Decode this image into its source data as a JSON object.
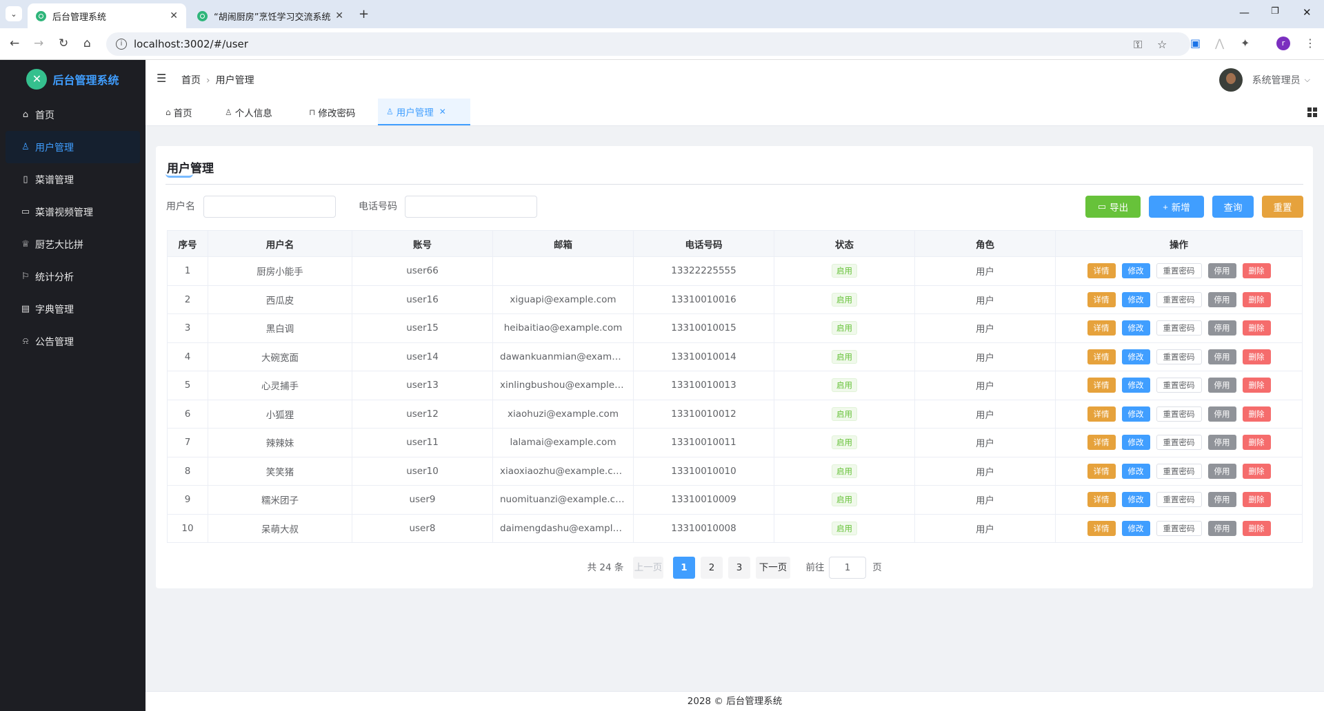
{
  "browser": {
    "tabs": [
      {
        "title": "后台管理系统",
        "active": true
      },
      {
        "title": "“胡闹厨房”烹饪学习交流系统",
        "active": false
      }
    ],
    "url": "localhost:3002/#/user",
    "profile_initial": "r"
  },
  "sidebar": {
    "app_title": "后台管理系统",
    "items": [
      {
        "label": "首页",
        "icon": "home-icon"
      },
      {
        "label": "用户管理",
        "icon": "user-icon",
        "active": true
      },
      {
        "label": "菜谱管理",
        "icon": "notebook-icon"
      },
      {
        "label": "菜谱视频管理",
        "icon": "video-icon"
      },
      {
        "label": "厨艺大比拼",
        "icon": "trophy-icon"
      },
      {
        "label": "统计分析",
        "icon": "flag-icon"
      },
      {
        "label": "字典管理",
        "icon": "document-icon"
      },
      {
        "label": "公告管理",
        "icon": "bell-icon"
      }
    ]
  },
  "header": {
    "breadcrumb": [
      "首页",
      "用户管理"
    ],
    "username": "系统管理员"
  },
  "tags": [
    {
      "label": "首页",
      "icon": "home-icon"
    },
    {
      "label": "个人信息",
      "icon": "user-icon"
    },
    {
      "label": "修改密码",
      "icon": "lock-icon"
    },
    {
      "label": "用户管理",
      "icon": "user-icon",
      "active": true
    }
  ],
  "page": {
    "title": "用户管理",
    "filters": {
      "username_label": "用户名",
      "username_value": "",
      "phone_label": "电话号码",
      "phone_value": ""
    },
    "buttons": {
      "export": "导出",
      "add": "新增",
      "query": "查询",
      "reset": "重置"
    },
    "columns": [
      "序号",
      "用户名",
      "账号",
      "邮箱",
      "电话号码",
      "状态",
      "角色",
      "操作"
    ],
    "row_actions": {
      "detail": "详情",
      "edit": "修改",
      "reset_pwd": "重置密码",
      "disable": "停用",
      "delete": "删除"
    },
    "rows": [
      {
        "no": "1",
        "name": "厨房小能手",
        "account": "user66",
        "email": "",
        "phone": "13322225555",
        "status": "启用",
        "role": "用户"
      },
      {
        "no": "2",
        "name": "西瓜皮",
        "account": "user16",
        "email": "xiguapi@example.com",
        "phone": "13310010016",
        "status": "启用",
        "role": "用户"
      },
      {
        "no": "3",
        "name": "黑白调",
        "account": "user15",
        "email": "heibaitiao@example.com",
        "phone": "13310010015",
        "status": "启用",
        "role": "用户"
      },
      {
        "no": "4",
        "name": "大碗宽面",
        "account": "user14",
        "email": "dawankuanmian@example.com",
        "phone": "13310010014",
        "status": "启用",
        "role": "用户"
      },
      {
        "no": "5",
        "name": "心灵捕手",
        "account": "user13",
        "email": "xinlingbushou@example.com",
        "phone": "13310010013",
        "status": "启用",
        "role": "用户"
      },
      {
        "no": "6",
        "name": "小狐狸",
        "account": "user12",
        "email": "xiaohuzi@example.com",
        "phone": "13310010012",
        "status": "启用",
        "role": "用户"
      },
      {
        "no": "7",
        "name": "辣辣妹",
        "account": "user11",
        "email": "lalamai@example.com",
        "phone": "13310010011",
        "status": "启用",
        "role": "用户"
      },
      {
        "no": "8",
        "name": "笑笑猪",
        "account": "user10",
        "email": "xiaoxiaozhu@example.com",
        "phone": "13310010010",
        "status": "启用",
        "role": "用户"
      },
      {
        "no": "9",
        "name": "糯米团子",
        "account": "user9",
        "email": "nuomituanzi@example.com",
        "phone": "13310010009",
        "status": "启用",
        "role": "用户"
      },
      {
        "no": "10",
        "name": "呆萌大叔",
        "account": "user8",
        "email": "daimengdashu@example.com",
        "phone": "13310010008",
        "status": "启用",
        "role": "用户"
      }
    ],
    "pagination": {
      "total_text": "共 24 条",
      "prev": "上一页",
      "pages": [
        "1",
        "2",
        "3"
      ],
      "current": "1",
      "next": "下一页",
      "goto_prefix": "前往",
      "goto_value": "1",
      "goto_suffix": "页"
    }
  },
  "footer": {
    "text": "2028 © 后台管理系统"
  },
  "colors": {
    "primary": "#409eff",
    "success": "#67c23a",
    "warning": "#e6a23c",
    "danger": "#f56c6c",
    "info": "#909399",
    "sidebar_bg": "#1d1e23"
  }
}
